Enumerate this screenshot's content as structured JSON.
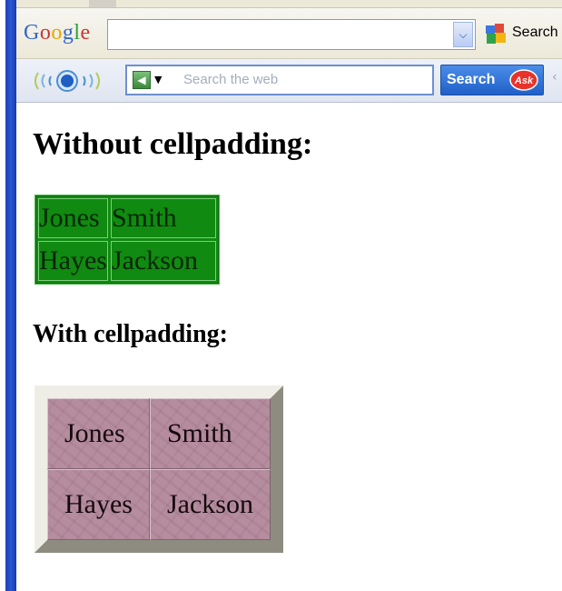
{
  "google_toolbar": {
    "logo_text": "Google",
    "search_value": "",
    "search_label": "Search",
    "search_icon": "google-multicolor-search-icon",
    "dropdown_icon": "chevron-down-icon"
  },
  "ask_toolbar": {
    "radio_icon": "radio-waves-icon",
    "engine_icon": "search-engine-icon",
    "engine_dropdown_icon": "triangle-down-icon",
    "placeholder": "Search the web",
    "search_button_label": "Search",
    "logo_text": "Ask",
    "more_icon": "chevron-right-icon"
  },
  "page": {
    "heading_without": "Without cellpadding:",
    "heading_with": "With cellpadding:",
    "table_without": [
      [
        "Jones",
        "Smith"
      ],
      [
        "Hayes",
        "Jackson"
      ]
    ],
    "table_with": [
      [
        "Jones",
        "Smith"
      ],
      [
        "Hayes",
        "Jackson"
      ]
    ]
  },
  "colors": {
    "window_border": "#2d57d6",
    "green_table_bg": "#108a10",
    "pink_table_bg": "#b58d9e",
    "ask_button": "#2060c8"
  }
}
